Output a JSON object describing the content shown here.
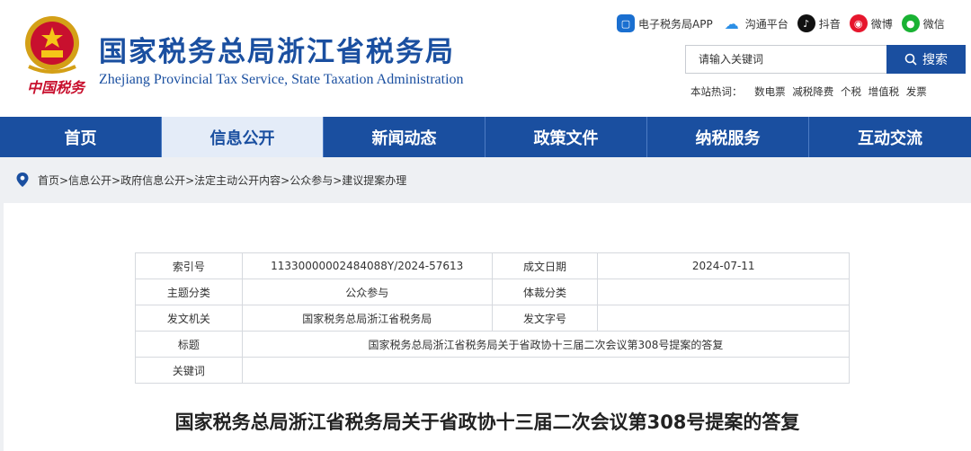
{
  "header": {
    "seal_text": "中国税务",
    "title_cn": "国家税务总局浙江省税务局",
    "title_en": "Zhejiang Provincial Tax Service, State Taxation Administration",
    "links": [
      {
        "label": "电子税务局APP",
        "icon": "app-icon"
      },
      {
        "label": "沟通平台",
        "icon": "cloud-icon"
      },
      {
        "label": "抖音",
        "icon": "tiktok-icon"
      },
      {
        "label": "微博",
        "icon": "weibo-icon"
      },
      {
        "label": "微信",
        "icon": "wechat-icon"
      }
    ],
    "search": {
      "placeholder": "请输入关键词",
      "button": "搜索"
    },
    "hot": {
      "label": "本站热词：",
      "keywords": [
        "数电票",
        "减税降费",
        "个税",
        "增值税",
        "发票"
      ]
    }
  },
  "nav": {
    "items": [
      "首页",
      "信息公开",
      "新闻动态",
      "政策文件",
      "纳税服务",
      "互动交流"
    ],
    "active_index": 1
  },
  "breadcrumb": "首页>信息公开>政府信息公开>法定主动公开内容>公众参与>建议提案办理",
  "meta": {
    "index_label": "索引号",
    "index_value": "11330000002484088Y/2024-57613",
    "date_label": "成文日期",
    "date_value": "2024-07-11",
    "topic_label": "主题分类",
    "topic_value": "公众参与",
    "genre_label": "体裁分类",
    "genre_value": "",
    "issuer_label": "发文机关",
    "issuer_value": "国家税务总局浙江省税务局",
    "docno_label": "发文字号",
    "docno_value": "",
    "title_label": "标题",
    "title_value": "国家税务总局浙江省税务局关于省政协十三届二次会议第308号提案的答复",
    "keywords_label": "关键词",
    "keywords_value": ""
  },
  "doc_title": "国家税务总局浙江省税务局关于省政协十三届二次会议第308号提案的答复",
  "colors": {
    "brand_blue": "#1a4fa0",
    "seal_red": "#c8102e"
  }
}
